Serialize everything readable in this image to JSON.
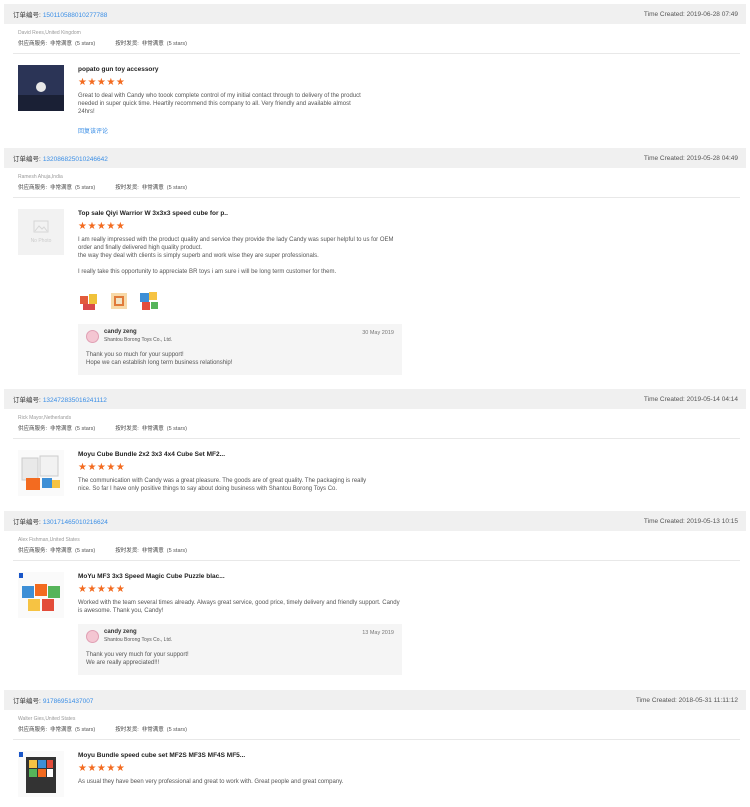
{
  "labels": {
    "order_label": "订单编号:",
    "time_created": "Time Created:",
    "supplier_service": "供应商服务:",
    "on_time_delivery": "按时发货:",
    "very_satisfied": "非常满意",
    "five_stars": "(5 stars)",
    "stars": "★★★★★"
  },
  "reviews": [
    {
      "order_no": "150110588010277788",
      "time": "2019-06-28 07:49",
      "buyer": "David Rees,United Kingdom",
      "product": "popato gun toy accessory",
      "text": "Great to deal with Candy who toook complete control of my initial contact through to delivery of the product needed in super quick time. Heartily recommend this company to all. Very friendly and available almost 24hrs!",
      "link": "回复该评论"
    },
    {
      "order_no": "132086825010246642",
      "time": "2019-05-28 04:49",
      "buyer": "Ramesh Ahuja,India",
      "product": "Top sale Qiyi Warrior W 3x3x3 speed cube for p..",
      "text1": "I am really impressed with the product quality and service they provide the lady Candy was super helpful to us for OEM order and finally delivered high quality product.",
      "text2": "the way they deal with clients is simply superb and work wise they are super professionals.",
      "text3": "I really take this opportunity to appreciate BR toys i am sure i will be long term customer for them.",
      "no_photo": "No Photo",
      "reply": {
        "name": "candy zeng",
        "company": "Shantou Borong Toys Co., Ltd.",
        "date": "30 May 2019",
        "line1": "Thank you so much for your support!",
        "line2": "Hope we can establish long term business relationship!"
      }
    },
    {
      "order_no": "132472835016241112",
      "time": "2019-05-14 04:14",
      "buyer": "Rick Mayor,Netherlands",
      "product": "Moyu Cube Bundle 2x2 3x3 4x4 Cube Set MF2...",
      "text": "The communication with Candy was a great pleasure. The goods are of great quality. The packaging is really nice. So far I have only positive things to say about doing business with Shantou Borong Toys Co."
    },
    {
      "order_no": "130171465010216624",
      "time": "2019-05-13 10:15",
      "buyer": "Alex Fishman,United States",
      "product": "MoYu MF3 3x3 Speed Magic Cube Puzzle blac...",
      "text": "Worked with the team several times already. Always great service, good price, timely delivery and friendly support. Candy is awesome. Thank you, Candy!",
      "reply": {
        "name": "candy zeng",
        "company": "Shantou Borong Toys Co., Ltd.",
        "date": "13 May 2019",
        "line1": "Thank you very much for your support!",
        "line2": "We are really appreciated!!!"
      }
    },
    {
      "order_no": "91786951437007",
      "time": "2018-05-31 11:11:12",
      "buyer": "Walter Gies,United States",
      "product": "Moyu Bundle speed cube set MF2S MF3S MF4S MF5...",
      "text": "As usual they have been very professional and great to work with.  Great people and great company."
    }
  ]
}
